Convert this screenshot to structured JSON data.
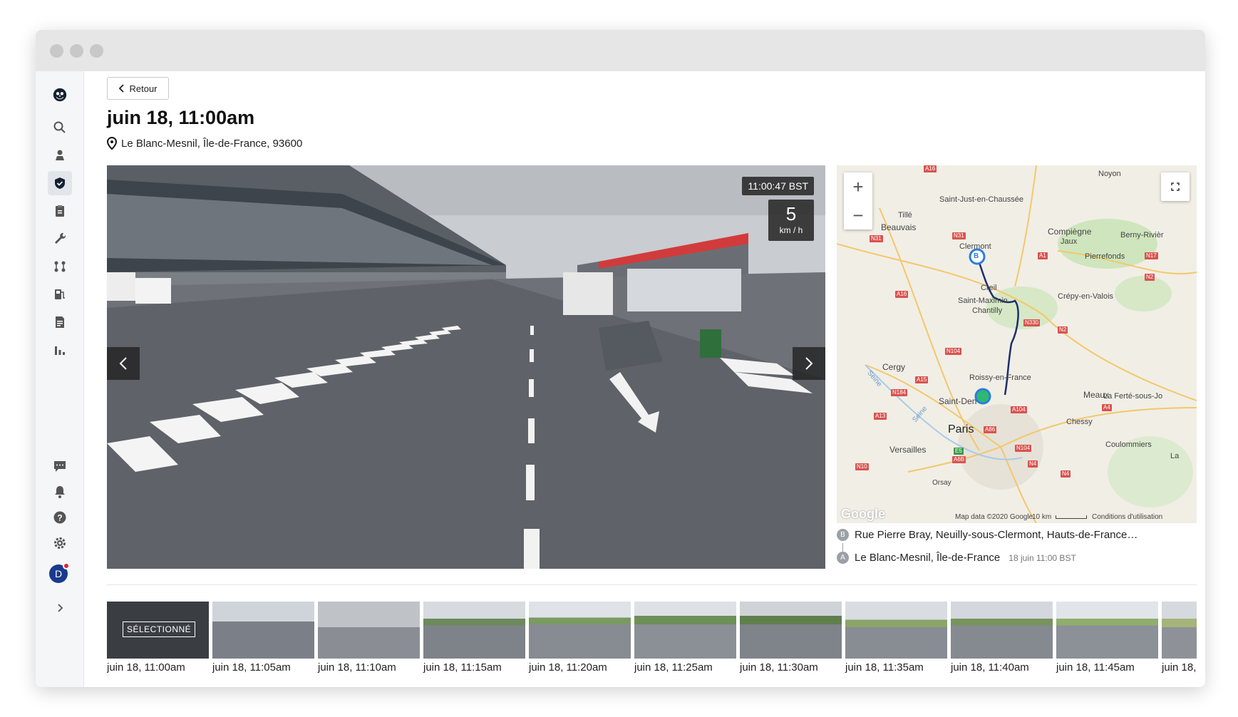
{
  "window": {
    "controls": [
      "close",
      "minimize",
      "maximize"
    ]
  },
  "sidebar": {
    "logo": "owl-logo-icon",
    "top_items": [
      {
        "icon": "search-icon"
      },
      {
        "icon": "map-pin-user-icon"
      },
      {
        "icon": "shield-check-icon",
        "active": true
      },
      {
        "icon": "clipboard-icon"
      },
      {
        "icon": "wrench-icon"
      },
      {
        "icon": "route-icon"
      },
      {
        "icon": "fuel-icon"
      },
      {
        "icon": "document-icon"
      },
      {
        "icon": "bar-chart-icon"
      }
    ],
    "bottom_items": [
      {
        "icon": "chat-icon"
      },
      {
        "icon": "bell-icon"
      },
      {
        "icon": "help-icon"
      },
      {
        "icon": "gear-icon"
      }
    ],
    "avatar_initial": "D",
    "expand_icon": "chevron-right-icon"
  },
  "header": {
    "back_label": "Retour",
    "title": "juin 18, 11:00am",
    "location": "Le Blanc-Mesnil, Île-de-France, 93600"
  },
  "video": {
    "timestamp": "11:00:47 BST",
    "speed_value": "5",
    "speed_unit": "km / h"
  },
  "map": {
    "labels": {
      "noyon": "Noyon",
      "saint_just": "Saint-Just-en-Chaussée",
      "tille": "Tillé",
      "beauvais": "Beauvais",
      "compiegne": "Compiègne",
      "jaux": "Jaux",
      "berny": "Berny-Rivièr",
      "clermont": "Clermont",
      "pierrefonds": "Pierrefonds",
      "creil": "Creil",
      "saint_maximin": "Saint-Maximin",
      "chantilly": "Chantilly",
      "crepy": "Crépy-en-Valois",
      "cergy": "Cergy",
      "roissy": "Roissy-en-France",
      "saint_denis": "Saint-Den",
      "meaux": "Meaux",
      "ferte": "La Ferté-sous-Jo",
      "paris": "Paris",
      "chessy": "Chessy",
      "versailles": "Versailles",
      "coulommiers": "Coulommiers",
      "la": "La",
      "seine1": "Seine",
      "seine2": "Seine",
      "orsay": "Orsay"
    },
    "roads": [
      "N31",
      "N31",
      "A16",
      "A1",
      "N2",
      "A16",
      "N330",
      "N2",
      "A15",
      "N184",
      "A13",
      "N104",
      "A104",
      "A4",
      "A86",
      "E5",
      "A6B",
      "N10",
      "N104",
      "N4",
      "N4",
      "N17"
    ],
    "footer": {
      "google": "Google",
      "data": "Map data ©2020 Google",
      "scale": "10 km",
      "terms": "Conditions d'utilisation"
    }
  },
  "route": {
    "stop_b": {
      "marker": "B",
      "address": "Rue Pierre Bray, Neuilly-sous-Clermont, Hauts-de-France…"
    },
    "stop_a": {
      "marker": "A",
      "address": "Le Blanc-Mesnil, Île-de-France",
      "meta": "18 juin 11:00 BST"
    },
    "colors": {
      "route_line": "#1c2e6e",
      "marker_b": "#2b7de0",
      "marker_a": "#2eb872"
    }
  },
  "thumbnails": [
    {
      "label": "juin 18, 11:00am",
      "selected": true,
      "tag": "SÉLECTIONNÉ"
    },
    {
      "label": "juin 18, 11:05am"
    },
    {
      "label": "juin 18, 11:10am"
    },
    {
      "label": "juin 18, 11:15am"
    },
    {
      "label": "juin 18, 11:20am"
    },
    {
      "label": "juin 18, 11:25am"
    },
    {
      "label": "juin 18, 11:30am"
    },
    {
      "label": "juin 18, 11:35am"
    },
    {
      "label": "juin 18, 11:40am"
    },
    {
      "label": "juin 18, 11:45am"
    },
    {
      "label": "juin 18,"
    }
  ]
}
